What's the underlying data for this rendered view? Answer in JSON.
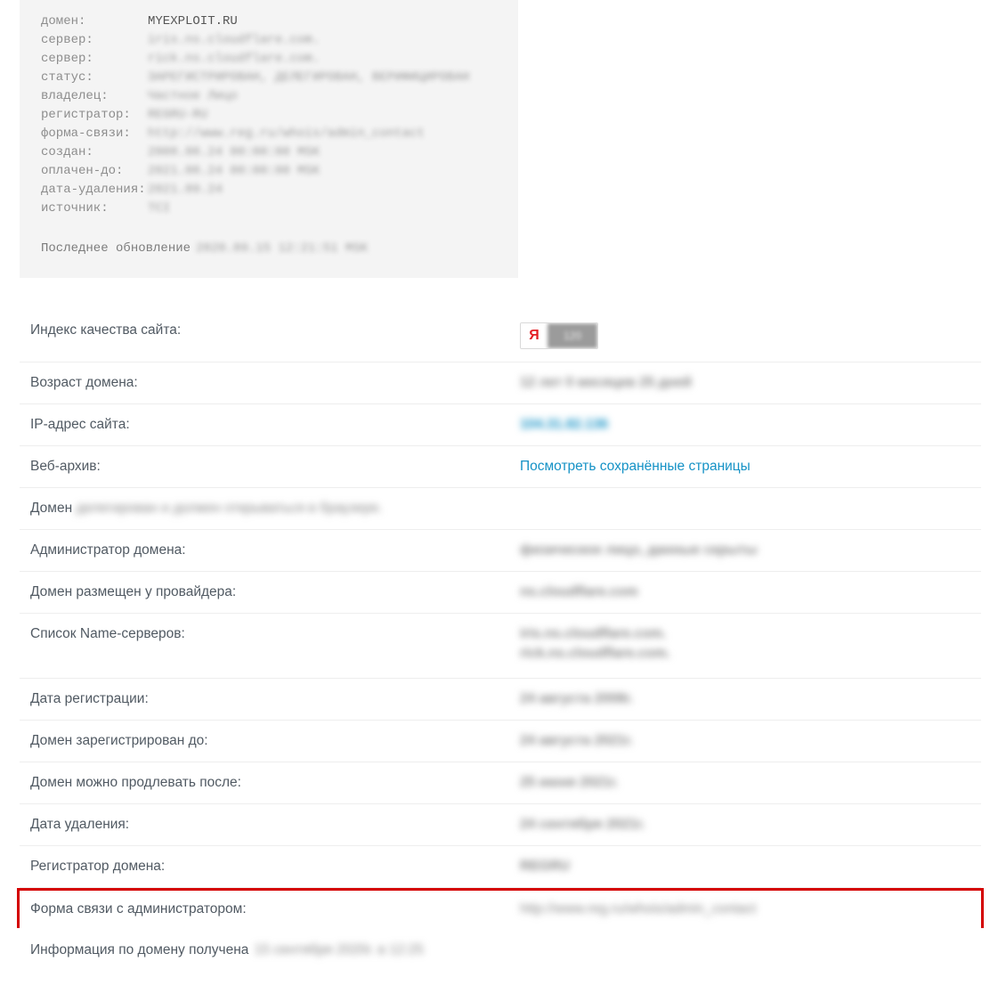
{
  "whois": {
    "rows": [
      {
        "key": "домен:",
        "val": "MYEXPLOIT.RU",
        "clear": true
      },
      {
        "key": "сервер:",
        "val": "iris.ns.cloudflare.com."
      },
      {
        "key": "сервер:",
        "val": "rick.ns.cloudflare.com."
      },
      {
        "key": "статус:",
        "val": "ЗАРЕГИСТРИРОВАН, ДЕЛЕГИРОВАН, ВЕРИФИЦИРОВАН"
      },
      {
        "key": "владелец:",
        "val": "Частное Лицо"
      },
      {
        "key": "регистратор:",
        "val": "REGRU-RU"
      },
      {
        "key": "форма-связи:",
        "val": "http://www.reg.ru/whois/admin_contact"
      },
      {
        "key": "создан:",
        "val": "2008.08.24 00:00:00 MSK"
      },
      {
        "key": "оплачен-до:",
        "val": "2021.08.24 00:00:00 MSK"
      },
      {
        "key": "дата-удаления:",
        "val": "2021.09.24"
      },
      {
        "key": "источник:",
        "val": "TCI"
      }
    ],
    "update_label": "Последнее обновление",
    "update_val": "2020.09.15 12:21:51 MSK"
  },
  "info_rows": [
    {
      "label": "Индекс качества сайта:",
      "type": "yandex",
      "y": "Я",
      "num": "120"
    },
    {
      "label": "Возраст домена:",
      "type": "blur",
      "val": "12 лет 0 месяцев 25 дней"
    },
    {
      "label": "IP-адрес сайта:",
      "type": "blur-link",
      "val": "104.31.82.136"
    },
    {
      "label": "Веб-архив:",
      "type": "link",
      "val": "Посмотреть сохранённые страницы"
    },
    {
      "label": "Домен",
      "type": "inline-blur",
      "val": "делегирован и должен открываться в браузере."
    },
    {
      "label": "Администратор домена:",
      "type": "blur",
      "val": "физическое лицо, данные скрыты"
    },
    {
      "label": "Домен размещен у провайдера:",
      "type": "blur",
      "val": "ns.cloudflare.com"
    },
    {
      "label": "Список Name-серверов:",
      "type": "blur-stack",
      "vals": [
        "iris.ns.cloudflare.com.",
        "rick.ns.cloudflare.com."
      ]
    },
    {
      "label": "Дата регистрации:",
      "type": "blur",
      "val": "24 августа 2008г."
    },
    {
      "label": "Домен зарегистрирован до:",
      "type": "blur",
      "val": "24 августа 2021г."
    },
    {
      "label": "Домен можно продлевать после:",
      "type": "blur",
      "val": "25 июня 2021г."
    },
    {
      "label": "Дата удаления:",
      "type": "blur",
      "val": "24 сентября 2021г."
    },
    {
      "label": "Регистратор домена:",
      "type": "blur",
      "val": "REGRU"
    },
    {
      "label": "Форма связи с администратором:",
      "type": "blur-text",
      "val": "http://www.reg.ru/whois/admin_contact",
      "highlight": true
    }
  ],
  "footer": {
    "prefix": "Информация по домену получена",
    "val": "15 сентября 2020г. в 12:25"
  }
}
